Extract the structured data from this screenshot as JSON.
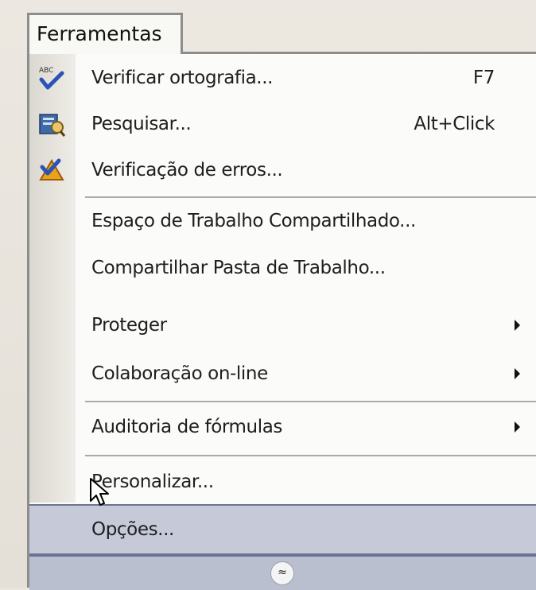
{
  "menu": {
    "title": "Ferramentas",
    "items": [
      {
        "label": "Verificar ortografia...",
        "shortcut": "F7",
        "icon": "spellcheck-icon"
      },
      {
        "label": "Pesquisar...",
        "shortcut": "Alt+Click",
        "icon": "research-icon"
      },
      {
        "label": "Verificação de erros...",
        "icon": "error-check-icon"
      },
      {
        "label": "Espaço de Trabalho Compartilhado..."
      },
      {
        "label": "Compartilhar Pasta de Trabalho..."
      },
      {
        "label": "Proteger",
        "submenu": true
      },
      {
        "label": "Colaboração on-line",
        "submenu": true
      },
      {
        "label": "Auditoria de fórmulas",
        "submenu": true
      },
      {
        "label": "Personalizar..."
      },
      {
        "label": "Opções...",
        "state": "hover"
      }
    ],
    "expand": {
      "glyph": "≈",
      "icon": "expand-chevrons-icon"
    }
  },
  "colors": {
    "menu_background": "#fbfbf9",
    "hover_background": "#c6cad8",
    "hover_border": "#6a7394",
    "icon_strip": "#dad8cf"
  }
}
